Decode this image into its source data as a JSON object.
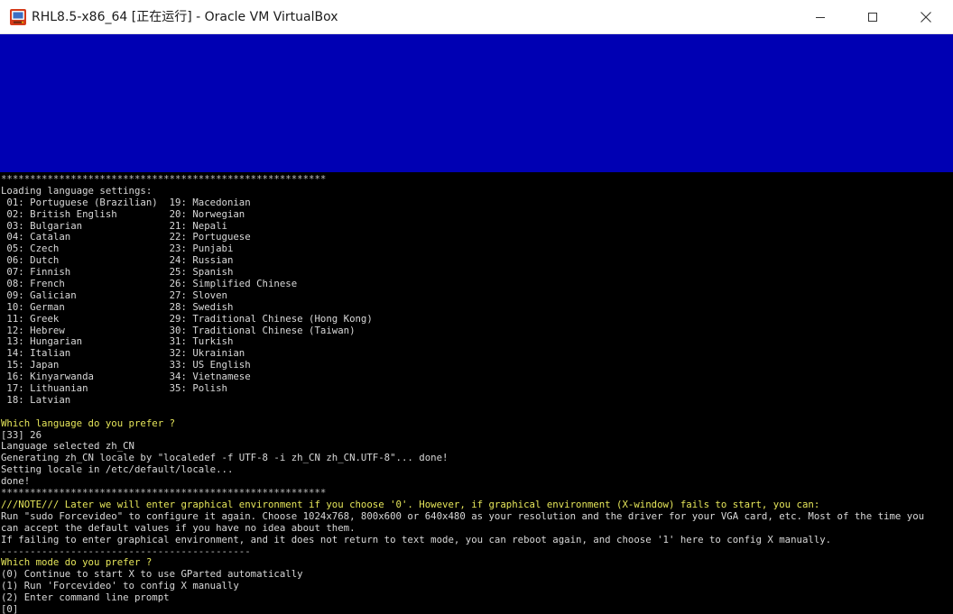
{
  "window": {
    "title": "RHL8.5-x86_64 [正在运行] - Oracle VM VirtualBox",
    "minimize_icon": "minimize-icon",
    "maximize_icon": "maximize-icon",
    "close_icon": "close-icon",
    "app_icon": "virtualbox-icon"
  },
  "colors": {
    "screen_blue": "#0000b3",
    "prompt_yellow": "#e6e65a",
    "text_gray": "#c8c8c8"
  },
  "console": {
    "lines": [
      {
        "text": "********************************************************",
        "style": "sep"
      },
      {
        "text": "Loading language settings:",
        "style": "w"
      },
      {
        "text": " 01: Portuguese (Brazilian)  19: Macedonian",
        "style": "w"
      },
      {
        "text": " 02: British English         20: Norwegian",
        "style": "w"
      },
      {
        "text": " 03: Bulgarian               21: Nepali",
        "style": "w"
      },
      {
        "text": " 04: Catalan                 22: Portuguese",
        "style": "w"
      },
      {
        "text": " 05: Czech                   23: Punjabi",
        "style": "w"
      },
      {
        "text": " 06: Dutch                   24: Russian",
        "style": "w"
      },
      {
        "text": " 07: Finnish                 25: Spanish",
        "style": "w"
      },
      {
        "text": " 08: French                  26: Simplified Chinese",
        "style": "w"
      },
      {
        "text": " 09: Galician                27: Sloven",
        "style": "w"
      },
      {
        "text": " 10: German                  28: Swedish",
        "style": "w"
      },
      {
        "text": " 11: Greek                   29: Traditional Chinese (Hong Kong)",
        "style": "w"
      },
      {
        "text": " 12: Hebrew                  30: Traditional Chinese (Taiwan)",
        "style": "w"
      },
      {
        "text": " 13: Hungarian               31: Turkish",
        "style": "w"
      },
      {
        "text": " 14: Italian                 32: Ukrainian",
        "style": "w"
      },
      {
        "text": " 15: Japan                   33: US English",
        "style": "w"
      },
      {
        "text": " 16: Kinyarwanda             34: Vietnamese",
        "style": "w"
      },
      {
        "text": " 17: Lithuanian              35: Polish",
        "style": "w"
      },
      {
        "text": " 18: Latvian",
        "style": "w"
      },
      {
        "text": "",
        "style": "w"
      },
      {
        "text": "Which language do you prefer ?",
        "style": "y"
      },
      {
        "text": "[33] 26",
        "style": "w"
      },
      {
        "text": "Language selected zh_CN",
        "style": "w"
      },
      {
        "text": "Generating zh_CN locale by \"localedef -f UTF-8 -i zh_CN zh_CN.UTF-8\"... done!",
        "style": "w"
      },
      {
        "text": "Setting locale in /etc/default/locale...",
        "style": "w"
      },
      {
        "text": "done!",
        "style": "w"
      },
      {
        "text": "********************************************************",
        "style": "sep"
      },
      {
        "text": "///NOTE/// Later we will enter graphical environment if you choose '0'. However, if graphical environment (X-window) fails to start, you can:",
        "style": "y"
      },
      {
        "text": "Run \"sudo Forcevideo\" to configure it again. Choose 1024x768, 800x600 or 640x480 as your resolution and the driver for your VGA card, etc. Most of the time you",
        "style": "w"
      },
      {
        "text": "can accept the default values if you have no idea about them.",
        "style": "w"
      },
      {
        "text": "If failing to enter graphical environment, and it does not return to text mode, you can reboot again, and choose '1' here to config X manually.",
        "style": "w"
      },
      {
        "text": "-------------------------------------------",
        "style": "sep"
      },
      {
        "text": "Which mode do you prefer ?",
        "style": "y"
      },
      {
        "text": "(0) Continue to start X to use GParted automatically",
        "style": "w"
      },
      {
        "text": "(1) Run 'Forcevideo' to config X manually",
        "style": "w"
      },
      {
        "text": "(2) Enter command line prompt",
        "style": "w"
      },
      {
        "text": "[0]",
        "style": "w"
      }
    ]
  }
}
